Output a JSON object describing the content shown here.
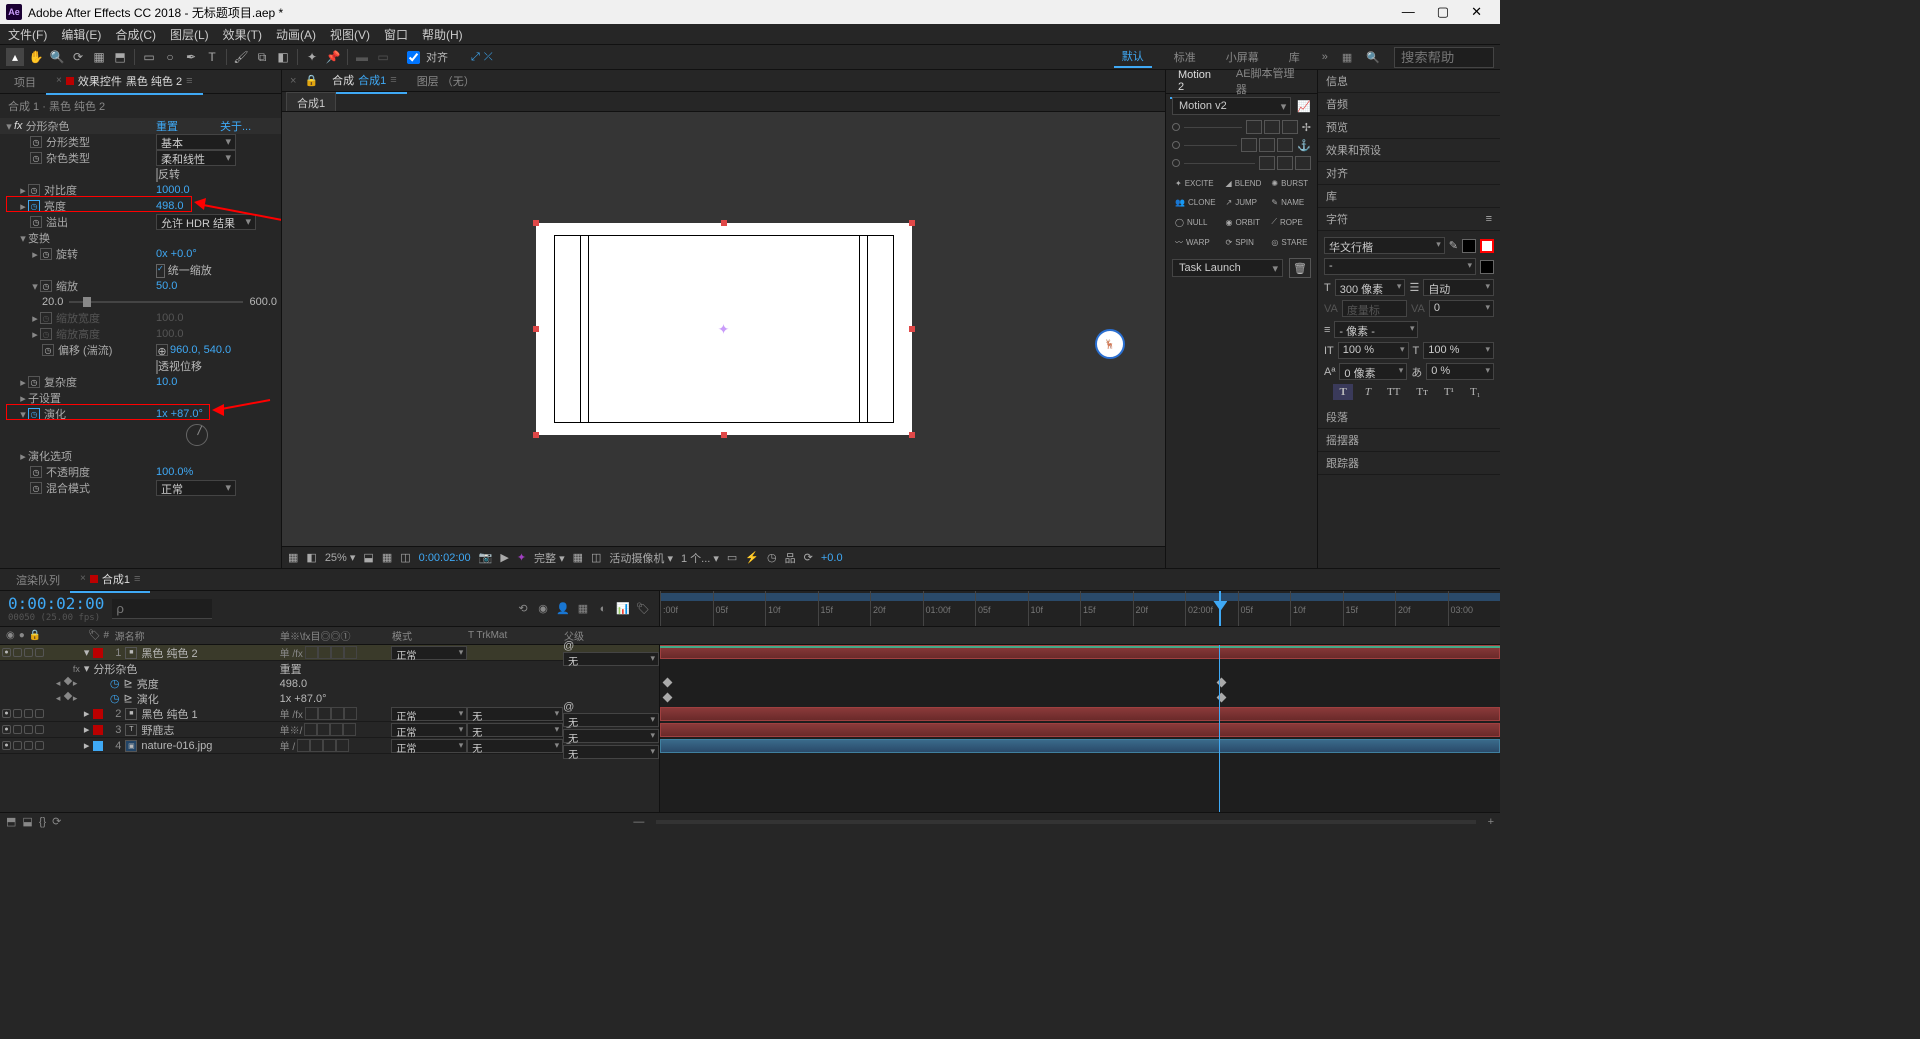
{
  "title": "Adobe After Effects CC 2018 - 无标题项目.aep *",
  "menu": [
    "文件(F)",
    "编辑(E)",
    "合成(C)",
    "图层(L)",
    "效果(T)",
    "动画(A)",
    "视图(V)",
    "窗口",
    "帮助(H)"
  ],
  "toolbar": {
    "snap": "对齐"
  },
  "workspace": {
    "items": [
      "默认",
      "标准",
      "小屏幕",
      "库"
    ],
    "active": 0,
    "search_ph": "搜索帮助"
  },
  "left": {
    "tab_project": "项目",
    "tab_effect_prefix": "效果控件",
    "tab_effect_name": "黑色 纯色 2",
    "breadcrumb": "合成 1 · 黑色 纯色 2",
    "fx": {
      "name": "分形杂色",
      "reset": "重置",
      "about": "关于...",
      "fractal_type_lbl": "分形类型",
      "fractal_type_val": "基本",
      "noise_type_lbl": "杂色类型",
      "noise_type_val": "柔和线性",
      "invert": "反转",
      "contrast_lbl": "对比度",
      "contrast_val": "1000.0",
      "brightness_lbl": "亮度",
      "brightness_val": "498.0",
      "overflow_lbl": "溢出",
      "overflow_val": "允许 HDR 结果",
      "transform_lbl": "变换",
      "rotation_lbl": "旋转",
      "rotation_val": "0x +0.0°",
      "uniform_scale": "统一缩放",
      "scale_lbl": "缩放",
      "scale_val": "50.0",
      "scale_min": "20.0",
      "scale_max": "600.0",
      "scale_w_lbl": "缩放宽度",
      "scale_w_val": "100.0",
      "scale_h_lbl": "缩放高度",
      "scale_h_val": "100.0",
      "offset_lbl": "偏移 (湍流)",
      "offset_val": "960.0, 540.0",
      "perspective": "透视位移",
      "complexity_lbl": "复杂度",
      "complexity_val": "10.0",
      "sub_lbl": "子设置",
      "evolution_lbl": "演化",
      "evolution_val": "1x +87.0°",
      "evo_opt_lbl": "演化选项",
      "opacity_lbl": "不透明度",
      "opacity_val": "100.0%",
      "blend_lbl": "混合模式",
      "blend_val": "正常"
    }
  },
  "center": {
    "tabs": {
      "comp_prefix": "合成",
      "comp_name": "合成1",
      "layer": "图层 （无）"
    },
    "sub_tab": "合成1",
    "viewbar": {
      "zoom": "25%",
      "tc": "0:00:02:00",
      "res": "完整",
      "cam": "活动摄像机",
      "views": "1 个...",
      "exp": "+0.0"
    }
  },
  "motion": {
    "tab1": "Motion 2",
    "tab2": "AE脚本管理器",
    "preset": "Motion v2",
    "tools": [
      "EXCITE",
      "BLEND",
      "BURST",
      "CLONE",
      "JUMP",
      "NAME",
      "NULL",
      "ORBIT",
      "ROPE",
      "WARP",
      "SPIN",
      "STARE"
    ],
    "task": "Task Launch"
  },
  "right_panels": [
    "信息",
    "音频",
    "预览",
    "效果和预设",
    "对齐",
    "库",
    "字符",
    "段落",
    "摇摆器",
    "跟踪器"
  ],
  "char": {
    "font": "华文行楷",
    "size": "300 像素",
    "lead": "自动",
    "kern": "度量标准",
    "track": "0",
    "units": "- 像素 -",
    "v": "100 %",
    "h": "100 %",
    "bl": "0 像素",
    "sp": "0 %"
  },
  "timeline": {
    "tab_render": "渲染队列",
    "tab_comp": "合成1",
    "tc": "0:00:02:00",
    "tc_sub": "00050 (25.00 fps)",
    "search_ph": "ρ",
    "cols": {
      "src": "源名称",
      "sw": "单※\\fx目◎◎①",
      "mode": "模式",
      "trk": "T  TrkMat",
      "parent": "父级"
    },
    "layers": [
      {
        "n": "1",
        "c": "#b00",
        "t": "■",
        "name": "黑色 纯色 2",
        "sw": "单   /fx",
        "mode": "正常",
        "trk": "",
        "parent": "无",
        "sel": true
      },
      {
        "n": "2",
        "c": "#b00",
        "t": "■",
        "name": "黑色 纯色 1",
        "sw": "单   /fx",
        "mode": "正常",
        "trk": "无",
        "parent": "无"
      },
      {
        "n": "3",
        "c": "#b00",
        "t": "T",
        "name": "野鹿志",
        "sw": "单※/",
        "mode": "正常",
        "trk": "无",
        "parent": "无"
      },
      {
        "n": "4",
        "c": "#3fa9f5",
        "t": "🖼",
        "name": "nature-016.jpg",
        "sw": "单   /",
        "mode": "正常",
        "trk": "无",
        "parent": "无"
      }
    ],
    "props": {
      "fx": "分形杂色",
      "reset": "重置",
      "bright": "亮度",
      "bright_v": "498.0",
      "evo": "演化",
      "evo_v": "1x +87.0°"
    },
    "ruler": [
      ":00f",
      "05f",
      "10f",
      "15f",
      "20f",
      "01:00f",
      "05f",
      "10f",
      "15f",
      "20f",
      "02:00f",
      "05f",
      "10f",
      "15f",
      "20f",
      "03:00"
    ]
  }
}
